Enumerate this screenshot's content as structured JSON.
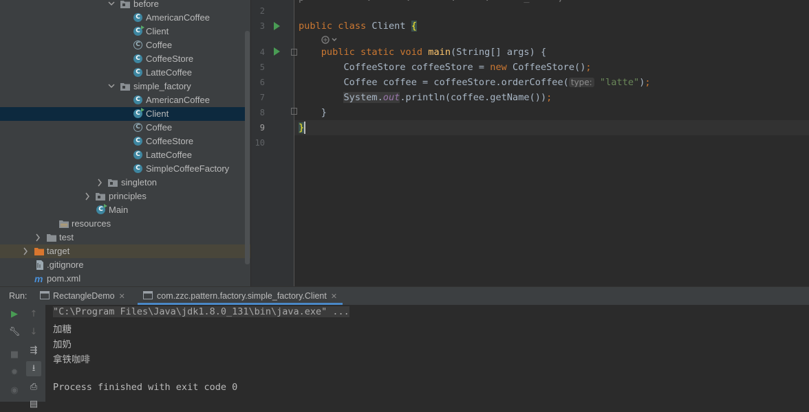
{
  "project_tree": [
    {
      "label": "before",
      "kind": "package",
      "expanded": true
    },
    {
      "label": "AmericanCoffee",
      "kind": "class"
    },
    {
      "label": "Client",
      "kind": "class-runnable"
    },
    {
      "label": "Coffee",
      "kind": "abstract-class"
    },
    {
      "label": "CoffeeStore",
      "kind": "class"
    },
    {
      "label": "LatteCoffee",
      "kind": "class"
    },
    {
      "label": "simple_factory",
      "kind": "package",
      "expanded": true
    },
    {
      "label": "AmericanCoffee",
      "kind": "class"
    },
    {
      "label": "Client",
      "kind": "class-runnable",
      "selected": true
    },
    {
      "label": "Coffee",
      "kind": "abstract-class"
    },
    {
      "label": "CoffeeStore",
      "kind": "class"
    },
    {
      "label": "LatteCoffee",
      "kind": "class"
    },
    {
      "label": "SimpleCoffeeFactory",
      "kind": "class"
    },
    {
      "label": "singleton",
      "kind": "package",
      "expanded": false
    },
    {
      "label": "principles",
      "kind": "package",
      "expanded": false
    },
    {
      "label": "Main",
      "kind": "class-runnable"
    },
    {
      "label": "resources",
      "kind": "resources-folder"
    },
    {
      "label": "test",
      "kind": "folder",
      "expanded": false
    },
    {
      "label": "target",
      "kind": "excluded-folder",
      "expanded": false
    },
    {
      "label": ".gitignore",
      "kind": "file"
    },
    {
      "label": "pom.xml",
      "kind": "maven-file"
    }
  ],
  "editor": {
    "line_numbers": [
      "2",
      "3",
      "4",
      "5",
      "6",
      "7",
      "8",
      "9",
      "10"
    ],
    "current_line": "9",
    "code": {
      "l3": {
        "kw1": "public",
        "kw2": "class",
        "name": "Client",
        "brace": "{"
      },
      "l4": {
        "kw1": "public",
        "kw2": "static",
        "kw3": "void",
        "fn": "main",
        "rest": "(String[] args) {"
      },
      "l5": {
        "type": "CoffeeStore coffeeStore = ",
        "kw": "new",
        "ctor": " CoffeeStore()",
        "semi": ";"
      },
      "l6": {
        "pre": "Coffee coffee = coffeeStore.orderCoffee(",
        "hint": "type:",
        "str": "\"latte\"",
        "post": ")",
        "semi": ";"
      },
      "l7": {
        "cls": "System.",
        "field": "out",
        "rest": ".println(coffee.getName())",
        "semi": ";"
      },
      "l8": {
        "brace": "}"
      },
      "l9": {
        "brace": "}"
      }
    }
  },
  "run_panel": {
    "label": "Run:",
    "tabs": [
      {
        "label": "RectangleDemo",
        "close": "✕"
      },
      {
        "label": "com.zzc.pattern.factory.simple_factory.Client",
        "close": "✕",
        "active": true
      }
    ],
    "console": [
      "\"C:\\Program Files\\Java\\jdk1.8.0_131\\bin\\java.exe\" ...",
      "加糖",
      "加奶",
      "拿铁咖啡",
      "",
      "Process finished with exit code 0"
    ]
  },
  "colors": {
    "accent": "#4a88c7",
    "keyword": "#cc7832",
    "function": "#ffc66d",
    "string": "#6a8759",
    "field": "#9876aa"
  }
}
